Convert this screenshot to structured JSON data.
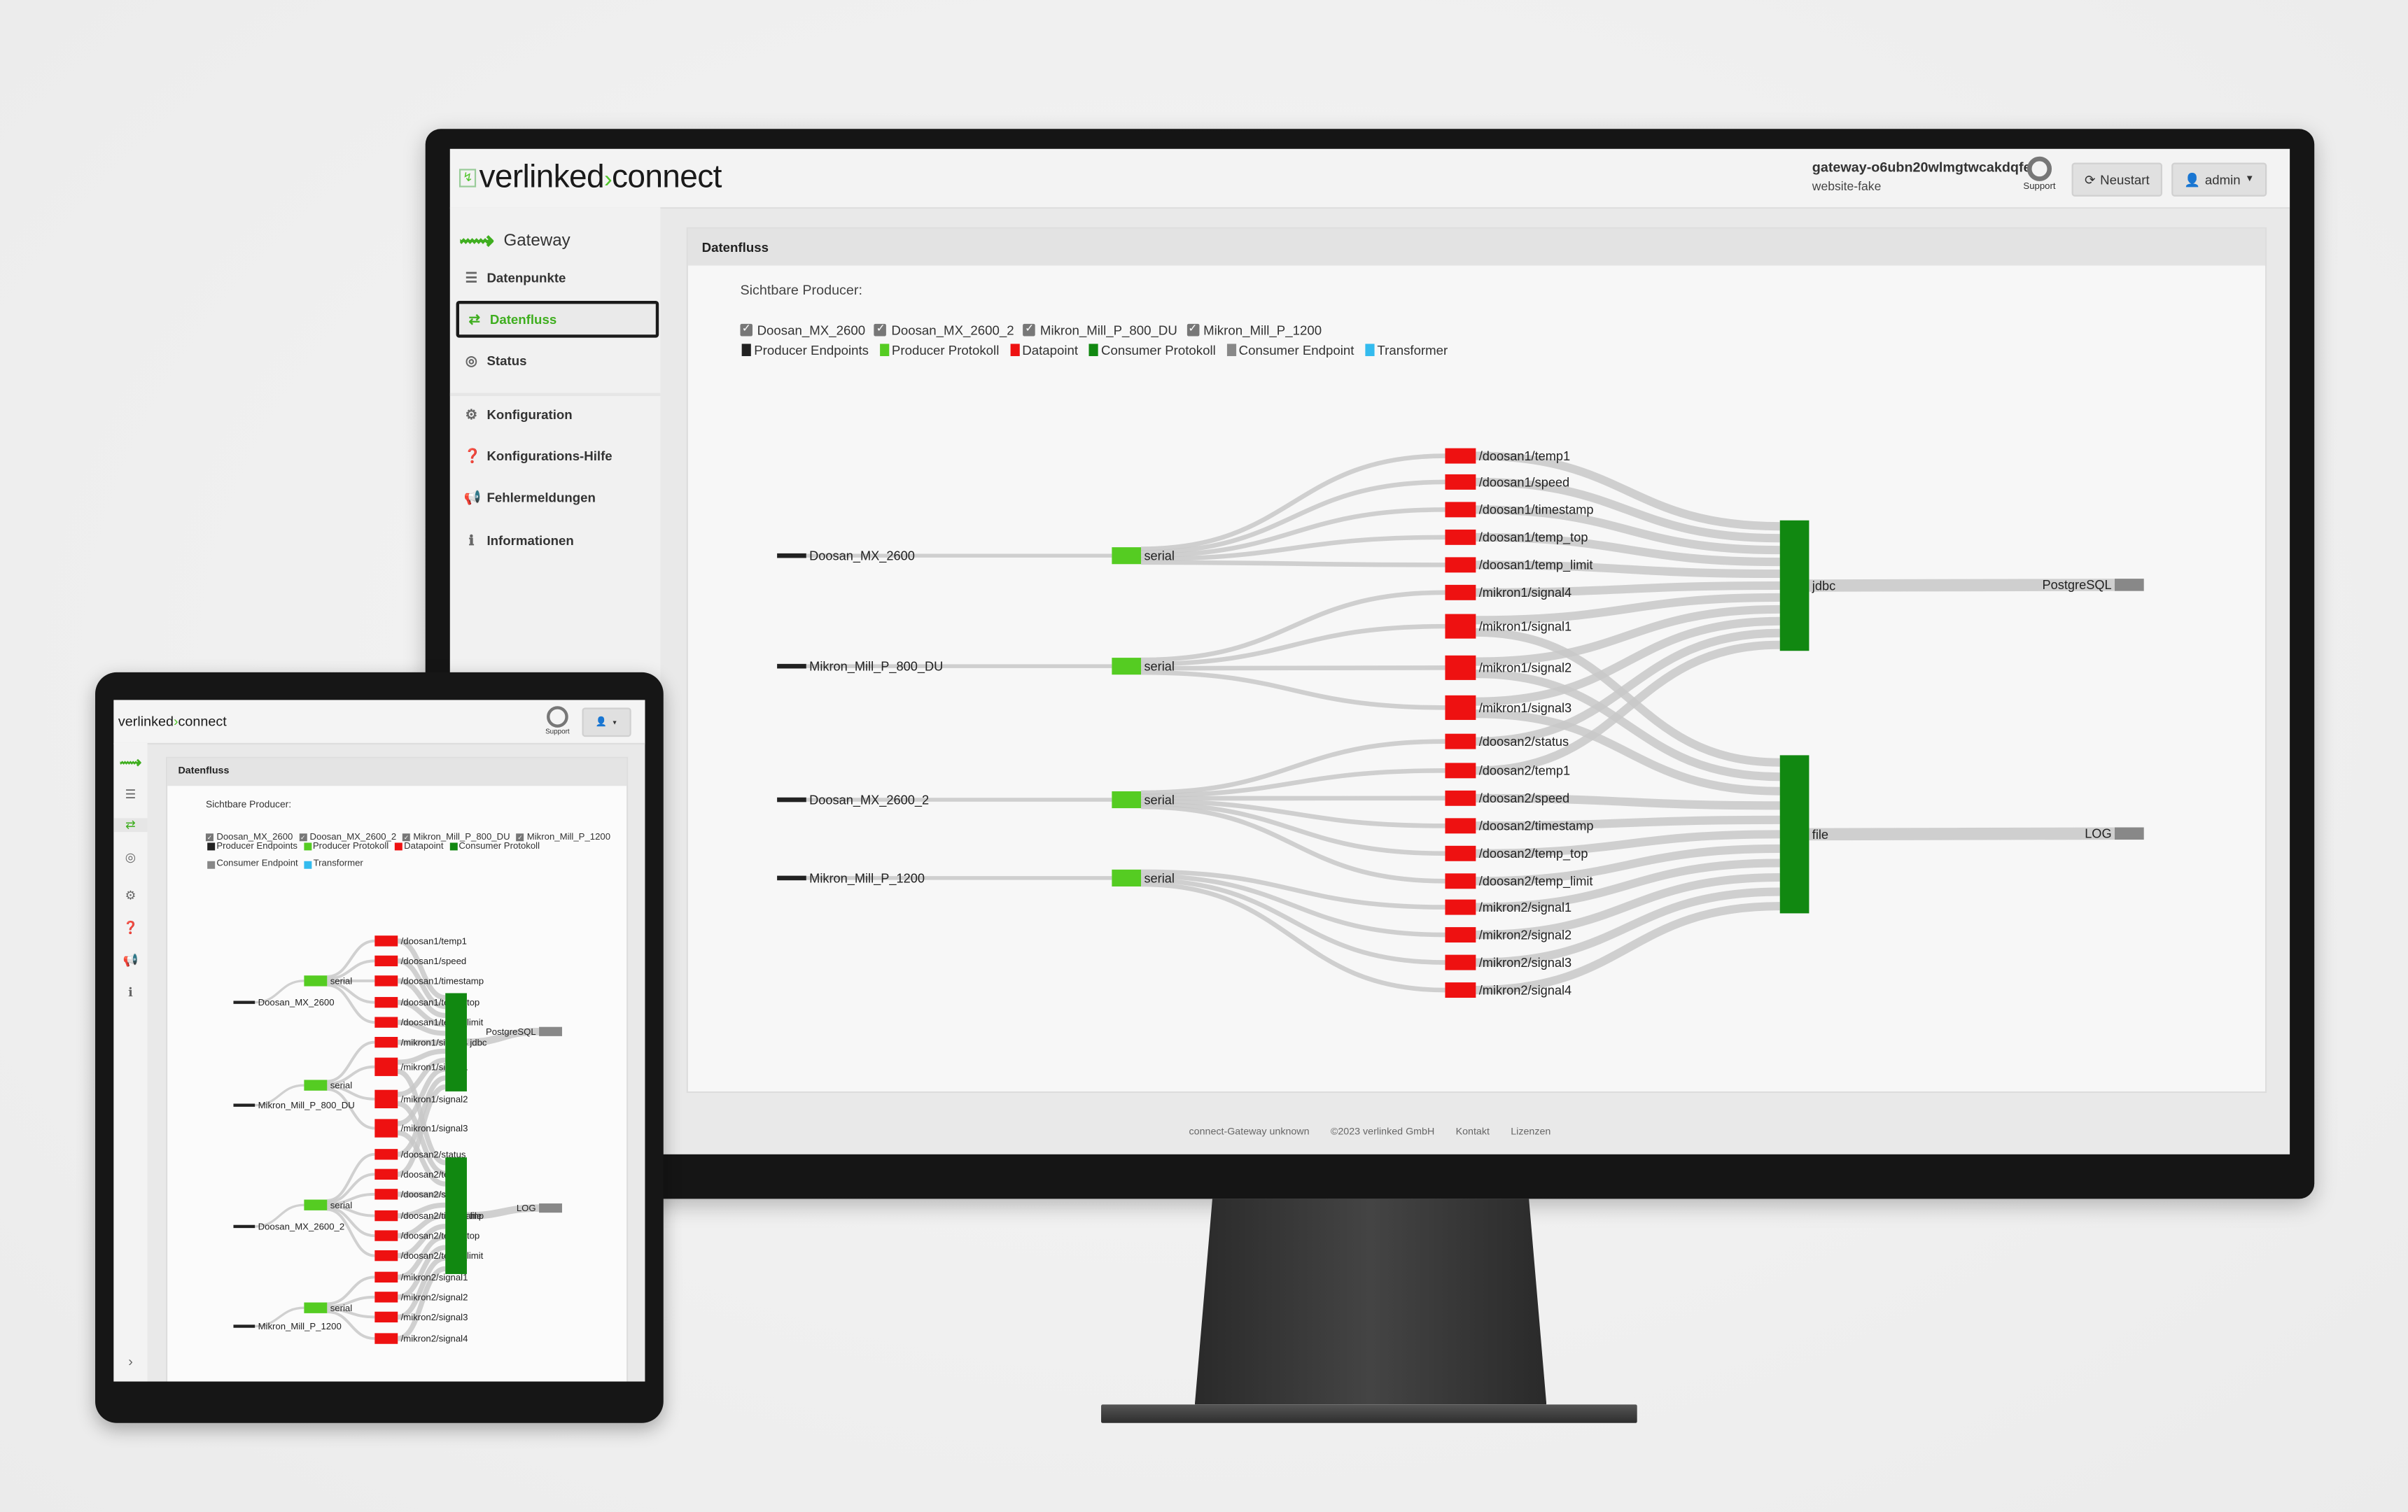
{
  "brand": {
    "name1": "verlinked",
    "sep": "›",
    "name2": "connect"
  },
  "header": {
    "gateway_id": "gateway-o6ubn20wlmgtwcakdqfe",
    "subtitle": "website-fake",
    "support_label": "Support",
    "restart_label": "Neustart",
    "user_label": "admin"
  },
  "sidebar": {
    "title": "Gateway",
    "items": [
      {
        "label": "Datenpunkte",
        "icon": "list-icon",
        "active": false
      },
      {
        "label": "Datenfluss",
        "icon": "exchange-icon",
        "active": true
      },
      {
        "label": "Status",
        "icon": "check-circle-icon",
        "active": false
      },
      {
        "label": "Konfiguration",
        "icon": "gear-icon",
        "active": false
      },
      {
        "label": "Konfigurations-Hilfe",
        "icon": "question-circle-icon",
        "active": false
      },
      {
        "label": "Fehlermeldungen",
        "icon": "bullhorn-icon",
        "active": false
      },
      {
        "label": "Informationen",
        "icon": "info-circle-icon",
        "active": false
      }
    ]
  },
  "panel": {
    "title": "Datenfluss",
    "producers_label": "Sichtbare Producer:",
    "producers": [
      {
        "label": "Doosan_MX_2600",
        "checked": true
      },
      {
        "label": "Doosan_MX_2600_2",
        "checked": true
      },
      {
        "label": "Mikron_Mill_P_800_DU",
        "checked": true
      },
      {
        "label": "Mikron_Mill_P_1200",
        "checked": true
      }
    ],
    "legend": [
      {
        "label": "Producer Endpoints",
        "color": "#222222"
      },
      {
        "label": "Producer Protokoll",
        "color": "#55cc22"
      },
      {
        "label": "Datapoint",
        "color": "#ee1111"
      },
      {
        "label": "Consumer Protokoll",
        "color": "#118811"
      },
      {
        "label": "Consumer Endpoint",
        "color": "#888888"
      },
      {
        "label": "Transformer",
        "color": "#33bbee"
      }
    ]
  },
  "footer": {
    "version": "connect-Gateway unknown",
    "copyright": "©2023 verlinked GmbH",
    "contact": "Kontakt",
    "licenses": "Lizenzen"
  },
  "sankey": {
    "link_color": "#c8c8c8",
    "nodes": [
      {
        "name": "Doosan_MX_2600",
        "type": "producer_endpoint"
      },
      {
        "name": "Mikron_Mill_P_800_DU",
        "type": "producer_endpoint"
      },
      {
        "name": "Doosan_MX_2600_2",
        "type": "producer_endpoint"
      },
      {
        "name": "Mikron_Mill_P_1200",
        "type": "producer_endpoint"
      },
      {
        "name": "serial",
        "type": "producer_protocol"
      },
      {
        "name": "serial",
        "type": "producer_protocol"
      },
      {
        "name": "serial",
        "type": "producer_protocol"
      },
      {
        "name": "serial",
        "type": "producer_protocol"
      },
      {
        "name": "/doosan1/temp1",
        "type": "datapoint"
      },
      {
        "name": "/doosan1/speed",
        "type": "datapoint"
      },
      {
        "name": "/doosan1/timestamp",
        "type": "datapoint"
      },
      {
        "name": "/doosan1/temp_top",
        "type": "datapoint"
      },
      {
        "name": "/doosan1/temp_limit",
        "type": "datapoint"
      },
      {
        "name": "/mikron1/signal4",
        "type": "datapoint"
      },
      {
        "name": "/mikron1/signal1",
        "type": "datapoint"
      },
      {
        "name": "/mikron1/signal2",
        "type": "datapoint"
      },
      {
        "name": "/mikron1/signal3",
        "type": "datapoint"
      },
      {
        "name": "/doosan2/status",
        "type": "datapoint"
      },
      {
        "name": "/doosan2/temp1",
        "type": "datapoint"
      },
      {
        "name": "/doosan2/speed",
        "type": "datapoint"
      },
      {
        "name": "/doosan2/timestamp",
        "type": "datapoint"
      },
      {
        "name": "/doosan2/temp_top",
        "type": "datapoint"
      },
      {
        "name": "/doosan2/temp_limit",
        "type": "datapoint"
      },
      {
        "name": "/mikron2/signal1",
        "type": "datapoint"
      },
      {
        "name": "/mikron2/signal2",
        "type": "datapoint"
      },
      {
        "name": "/mikron2/signal3",
        "type": "datapoint"
      },
      {
        "name": "/mikron2/signal4",
        "type": "datapoint"
      },
      {
        "name": "jdbc",
        "type": "consumer_protocol"
      },
      {
        "name": "file",
        "type": "consumer_protocol"
      },
      {
        "name": "PostgreSQL",
        "type": "consumer_endpoint"
      },
      {
        "name": "LOG",
        "type": "consumer_endpoint"
      }
    ],
    "links": [
      [
        0,
        4
      ],
      [
        1,
        5
      ],
      [
        2,
        6
      ],
      [
        3,
        7
      ],
      [
        4,
        8
      ],
      [
        4,
        9
      ],
      [
        4,
        10
      ],
      [
        4,
        11
      ],
      [
        4,
        12
      ],
      [
        5,
        13
      ],
      [
        5,
        14
      ],
      [
        5,
        15
      ],
      [
        5,
        16
      ],
      [
        6,
        17
      ],
      [
        6,
        18
      ],
      [
        6,
        19
      ],
      [
        6,
        20
      ],
      [
        6,
        21
      ],
      [
        6,
        22
      ],
      [
        7,
        23
      ],
      [
        7,
        24
      ],
      [
        7,
        25
      ],
      [
        7,
        26
      ],
      [
        8,
        27
      ],
      [
        9,
        27
      ],
      [
        10,
        27
      ],
      [
        11,
        27
      ],
      [
        12,
        27
      ],
      [
        13,
        27
      ],
      [
        14,
        27
      ],
      [
        15,
        27
      ],
      [
        16,
        27
      ],
      [
        17,
        27
      ],
      [
        18,
        27
      ],
      [
        14,
        28
      ],
      [
        15,
        28
      ],
      [
        16,
        28
      ],
      [
        19,
        28
      ],
      [
        20,
        28
      ],
      [
        21,
        28
      ],
      [
        22,
        28
      ],
      [
        23,
        28
      ],
      [
        24,
        28
      ],
      [
        25,
        28
      ],
      [
        26,
        28
      ],
      [
        27,
        29
      ],
      [
        28,
        30
      ]
    ]
  }
}
